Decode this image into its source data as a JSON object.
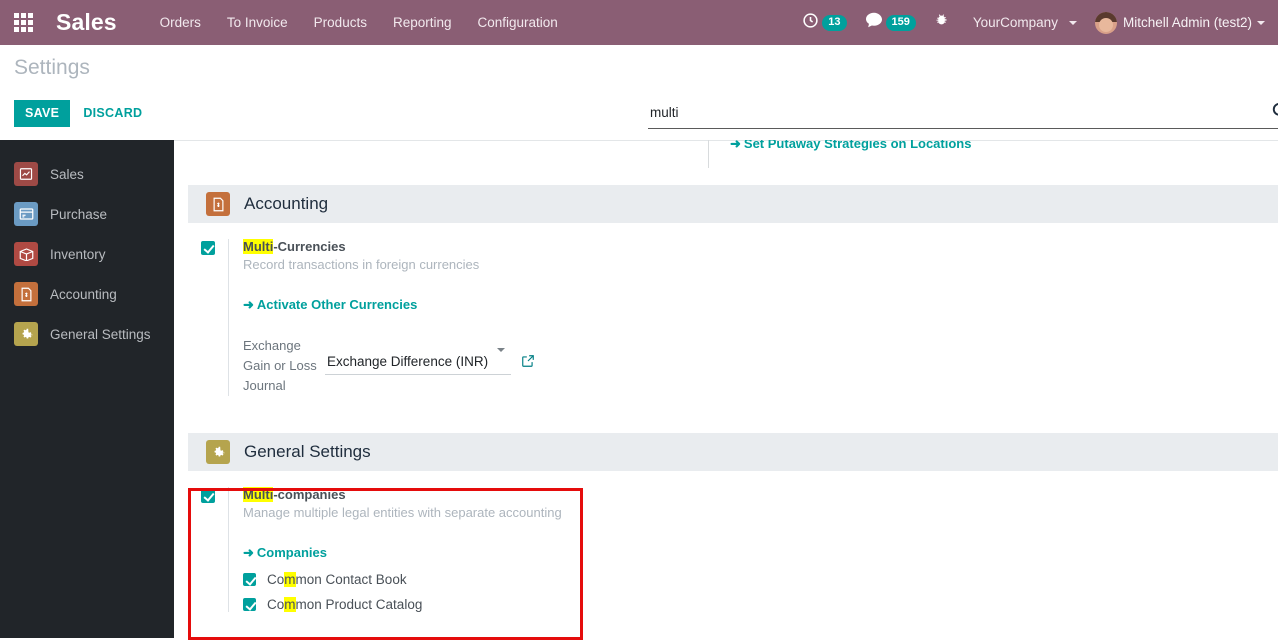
{
  "navbar": {
    "apps_icon": "apps-grid-icon",
    "brand": "Sales",
    "menu": [
      {
        "label": "Orders"
      },
      {
        "label": "To Invoice"
      },
      {
        "label": "Products"
      },
      {
        "label": "Reporting"
      },
      {
        "label": "Configuration"
      }
    ],
    "systray": {
      "activity_icon": "clock-icon",
      "activity_count": "13",
      "messaging_icon": "chat-icon",
      "messaging_count": "159",
      "debug_icon": "bug-icon",
      "company": "YourCompany",
      "user": "Mitchell Admin (test2)",
      "avatar_icon": "avatar"
    },
    "accent_color": "#8a5e74",
    "badge_color": "#00a09d"
  },
  "control_panel": {
    "title": "Settings",
    "save_label": "SAVE",
    "discard_label": "DISCARD",
    "search": {
      "value": "multi",
      "placeholder": "Search...",
      "icon": "search-icon"
    }
  },
  "sidebar": {
    "items": [
      {
        "label": "Sales",
        "icon": "sales-icon",
        "icon_color": "#9e4a46"
      },
      {
        "label": "Purchase",
        "icon": "purchase-icon",
        "icon_color": "#6b9bc3"
      },
      {
        "label": "Inventory",
        "icon": "inventory-icon",
        "icon_color": "#b04a43"
      },
      {
        "label": "Accounting",
        "icon": "accounting-icon",
        "icon_color": "#c4703c"
      },
      {
        "label": "General Settings",
        "icon": "general-settings-icon",
        "icon_color": "#b5a44e"
      }
    ],
    "background_color": "#212529"
  },
  "content": {
    "partial_link": "Set Putaway Strategies on Locations",
    "sections": [
      {
        "title": "Accounting",
        "icon": "accounting-icon",
        "icon_color": "#c4703c",
        "setting": {
          "label_highlight": "Multi",
          "label_rest": "-Currencies",
          "description": "Record transactions in foreign currencies",
          "checked": true,
          "link": "Activate Other Currencies",
          "field": {
            "label": "Exchange Gain or Loss Journal",
            "value": "Exchange Difference (INR)",
            "external_link_icon": "external-link-icon",
            "caret_icon": "chevron-down-icon"
          }
        }
      },
      {
        "title": "General Settings",
        "icon": "general-settings-icon",
        "icon_color": "#b5a44e",
        "setting": {
          "label_highlight": "Multi",
          "label_rest": "-companies",
          "description": "Manage multiple legal entities with separate accounting",
          "checked": true,
          "link": "Companies",
          "sub_options": [
            {
              "pre": "Co",
              "highlight": "m",
              "post": "mon Contact Book",
              "checked": true
            },
            {
              "pre": "Co",
              "highlight": "m",
              "post": "mon Product Catalog",
              "checked": true
            }
          ]
        }
      }
    ]
  },
  "annotation": {
    "color": "#e50c0c",
    "target": "multi-companies-setting"
  }
}
